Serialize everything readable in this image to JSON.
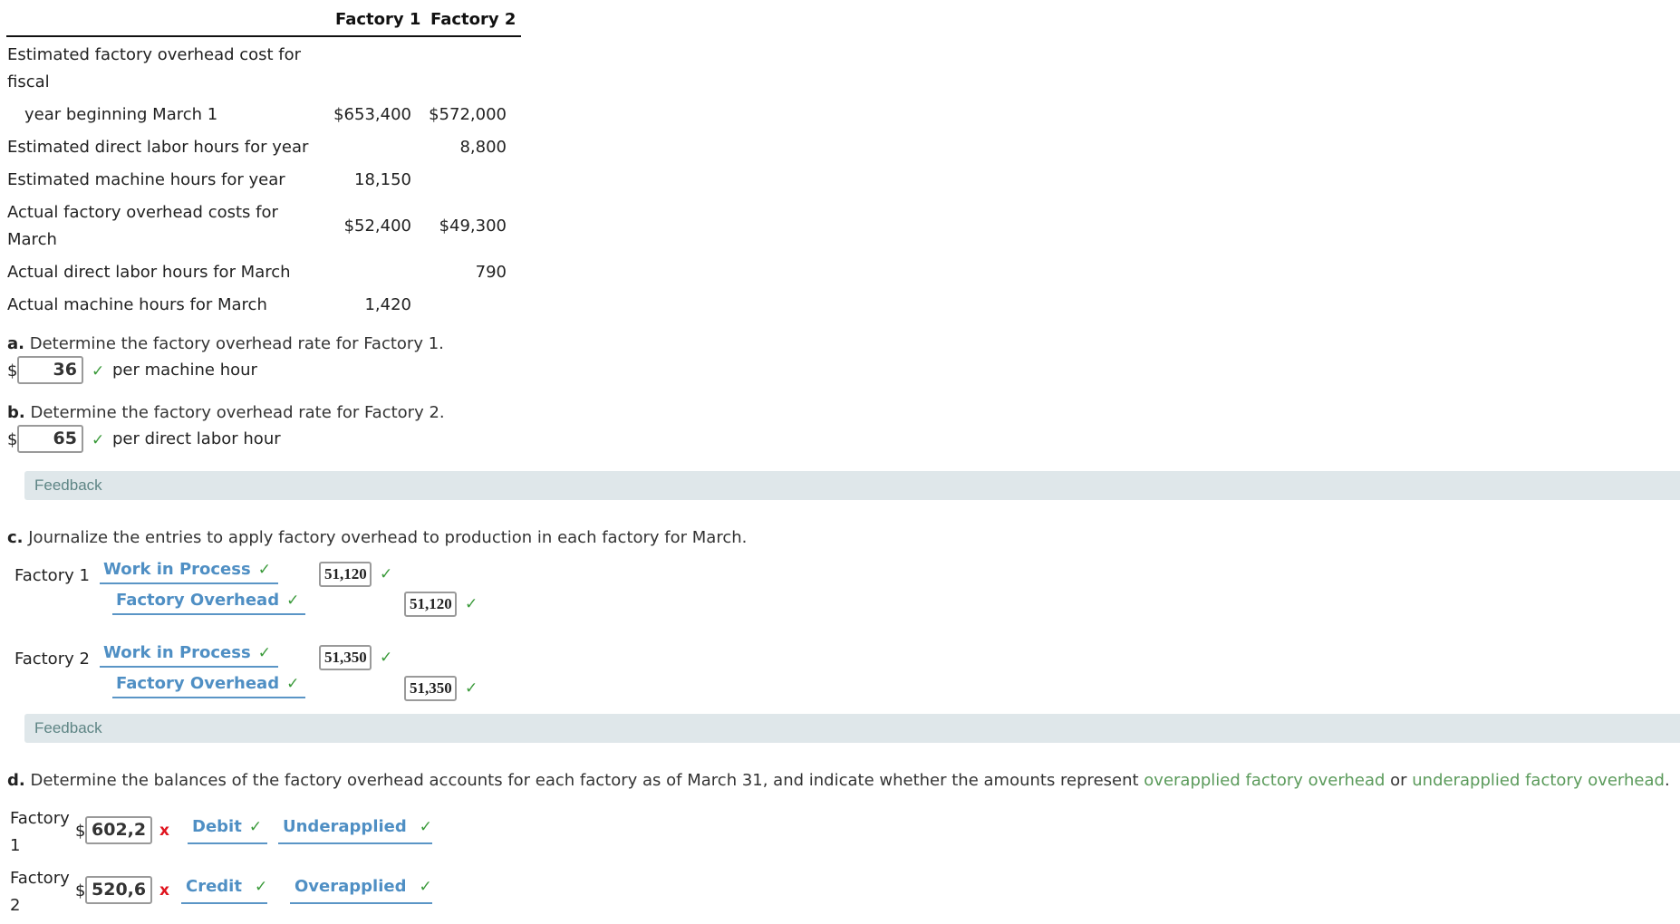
{
  "table": {
    "headers": [
      "Factory 1",
      "Factory 2"
    ],
    "rows": [
      {
        "label_lines": [
          "Estimated factory overhead cost for",
          "fiscal"
        ],
        "f1": "",
        "f2": ""
      },
      {
        "label": "year beginning March 1",
        "f1": "$653,400",
        "f2": "$572,000"
      },
      {
        "label": "Estimated direct labor hours for year",
        "f1": "",
        "f2": "8,800"
      },
      {
        "label": "Estimated machine hours for year",
        "f1": "18,150",
        "f2": ""
      },
      {
        "label_lines": [
          "Actual factory overhead costs for",
          "March"
        ],
        "f1": "$52,400",
        "f2": "$49,300"
      },
      {
        "label": "Actual direct labor hours for March",
        "f1": "",
        "f2": "790"
      },
      {
        "label": "Actual machine hours for March",
        "f1": "1,420",
        "f2": ""
      }
    ]
  },
  "part_a": {
    "letter": "a.",
    "question": "Determine the factory overhead rate for Factory 1.",
    "currency": "$",
    "value": "36",
    "status": "correct",
    "unit": "per machine hour"
  },
  "part_b": {
    "letter": "b.",
    "question": "Determine the factory overhead rate for Factory 2.",
    "currency": "$",
    "value": "65",
    "status": "correct",
    "unit": "per direct labor hour"
  },
  "feedback_label": "Feedback",
  "part_c": {
    "letter": "c.",
    "question": "Journalize the entries to apply factory overhead to production in each factory for March.",
    "entries": [
      {
        "factory": "Factory 1",
        "debit_account": "Work in Process",
        "debit_amount": "51,120",
        "credit_account": "Factory Overhead",
        "credit_amount": "51,120"
      },
      {
        "factory": "Factory 2",
        "debit_account": "Work in Process",
        "debit_amount": "51,350",
        "credit_account": "Factory Overhead",
        "credit_amount": "51,350"
      }
    ]
  },
  "part_d": {
    "letter": "d.",
    "question_start": "Determine the balances of the factory overhead accounts for each factory as of March 31, and indicate whether the amounts represent ",
    "link1": "overapplied factory overhead",
    "mid": " or ",
    "link2": "underapplied factory overhead",
    "end": ".",
    "rows": [
      {
        "factory_line1": "Factory",
        "factory_line2": "1",
        "currency": "$",
        "value": "602,2",
        "value_status": "incorrect",
        "side": "Debit",
        "type": "Underapplied"
      },
      {
        "factory_line1": "Factory",
        "factory_line2": "2",
        "currency": "$",
        "value": "520,6",
        "value_status": "incorrect",
        "side": "Credit",
        "type": "Overapplied"
      }
    ]
  },
  "icons": {
    "check": "✓",
    "cross": "x"
  },
  "colors": {
    "correct": "#3a9a3a",
    "incorrect": "#e0141e",
    "dropdown": "#4f8fc4",
    "feedback_bg": "#dfe7ea",
    "link": "#5a9a5a"
  }
}
